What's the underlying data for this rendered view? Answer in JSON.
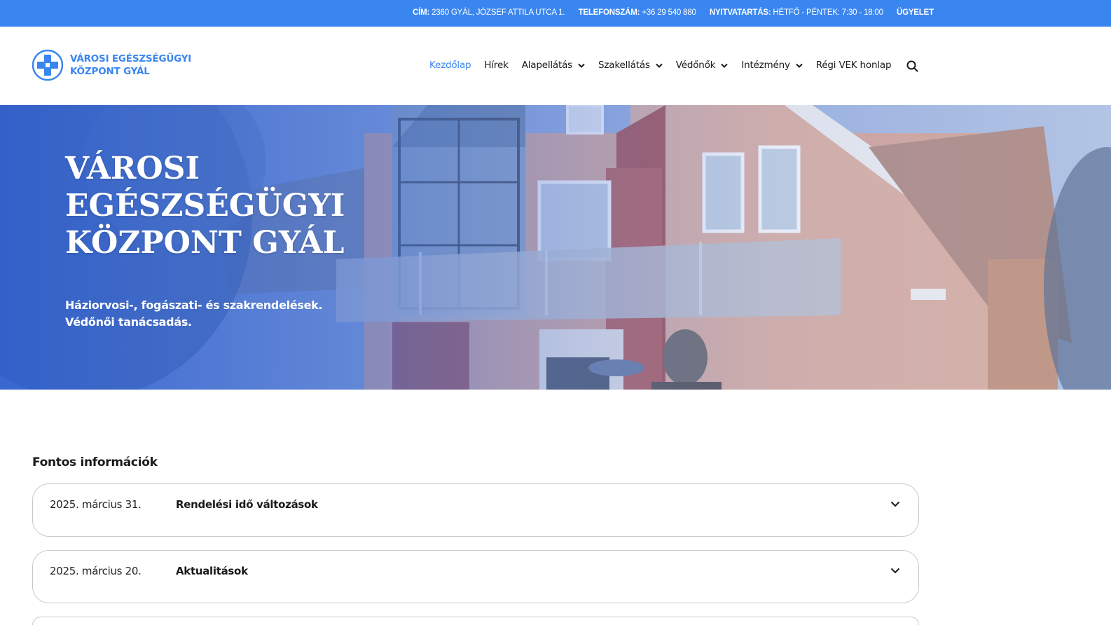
{
  "topbar": {
    "address_label": "CÍM:",
    "address_value": "2360 GYÁL, JÓZSEF ATTILA UTCA 1.",
    "phone_label": "TELEFONSZÁM:",
    "phone_value": "+36 29 540 880",
    "hours_label": "NYITVATARTÁS:",
    "hours_value": "HÉTFŐ - PÉNTEK: 7:30 - 18:00",
    "duty_label": "ÜGYELET"
  },
  "logo": {
    "line1": "VÁROSI EGÉSZSÉGÜGYI",
    "line2": "KÖZPONT GYÁL",
    "icon": "medical-cross-icon"
  },
  "nav": {
    "items": [
      {
        "label": "Kezdőlap",
        "active": true,
        "dropdown": false
      },
      {
        "label": "Hírek",
        "active": false,
        "dropdown": false
      },
      {
        "label": "Alapellátás",
        "active": false,
        "dropdown": true
      },
      {
        "label": "Szakellátás",
        "active": false,
        "dropdown": true
      },
      {
        "label": "Védőnők",
        "active": false,
        "dropdown": true
      },
      {
        "label": "Intézmény",
        "active": false,
        "dropdown": true
      },
      {
        "label": "Régi VEK honlap",
        "active": false,
        "dropdown": false
      }
    ],
    "search_icon": "search-icon"
  },
  "hero": {
    "title_line1": "VÁROSI",
    "title_line2": "EGÉSZSÉGÜGYI",
    "title_line3": "KÖZPONT GYÁL",
    "subtitle_line1": "Háziorvosi-, fogászati- és szakrendelések.",
    "subtitle_line2": "Védőnői tanácsadás."
  },
  "info": {
    "section_title": "Fontos információk",
    "items": [
      {
        "date": "2025. március 31.",
        "title": "Rendelési idő változások"
      },
      {
        "date": "2025. március 20.",
        "title": "Aktualitások"
      }
    ]
  },
  "colors": {
    "accent": "#3a86f0",
    "text": "#1a1a1a",
    "border": "#c9c9c9"
  }
}
